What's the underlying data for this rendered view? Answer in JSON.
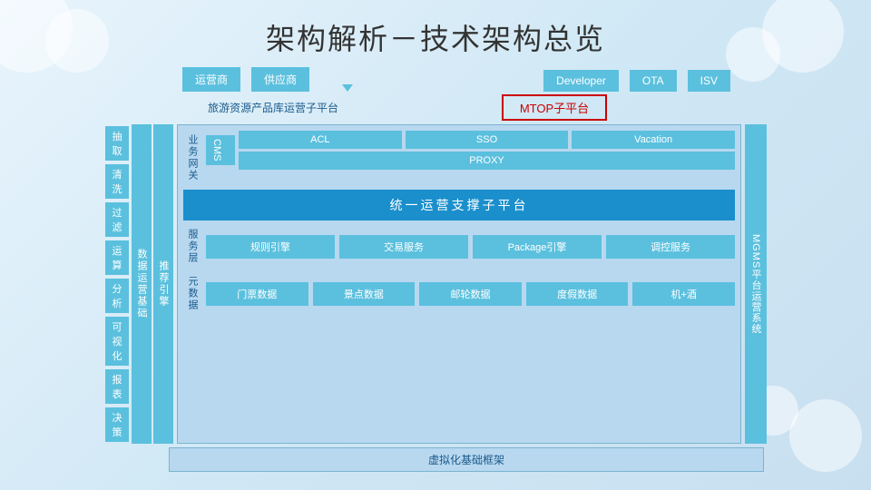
{
  "title": "架构解析－技术架构总览",
  "top_boxes": {
    "left_group": [
      "运营商",
      "供应商"
    ],
    "right_group": [
      "Developer",
      "OTA",
      "ISV"
    ]
  },
  "subtitle_left": "旅游资源产品库运营子平台",
  "subtitle_right": "MTOP子平台",
  "left_labels": [
    "抽取",
    "清洗",
    "过滤",
    "运算",
    "分析",
    "可视化",
    "报表",
    "决策"
  ],
  "vert_labels_left": [
    "数据运营基础",
    "推荐引擎"
  ],
  "vert_label_right": "MGMS平台运营系统",
  "sections": {
    "bizgate": "业务网关",
    "service_layer": "服务层",
    "meta_data": "元数据"
  },
  "cms": "CMS",
  "inner_boxes_row1": [
    "ACL",
    "SSO",
    "Vacation"
  ],
  "proxy": "PROXY",
  "unified": "统一运营支撑子平台",
  "service_boxes": [
    "规则引擎",
    "交易服务",
    "Package引擎",
    "调控服务"
  ],
  "meta_boxes": [
    "门票数据",
    "景点数据",
    "邮轮数据",
    "度假数据",
    "机+酒"
  ],
  "bottom_label": "虚拟化基础框架"
}
